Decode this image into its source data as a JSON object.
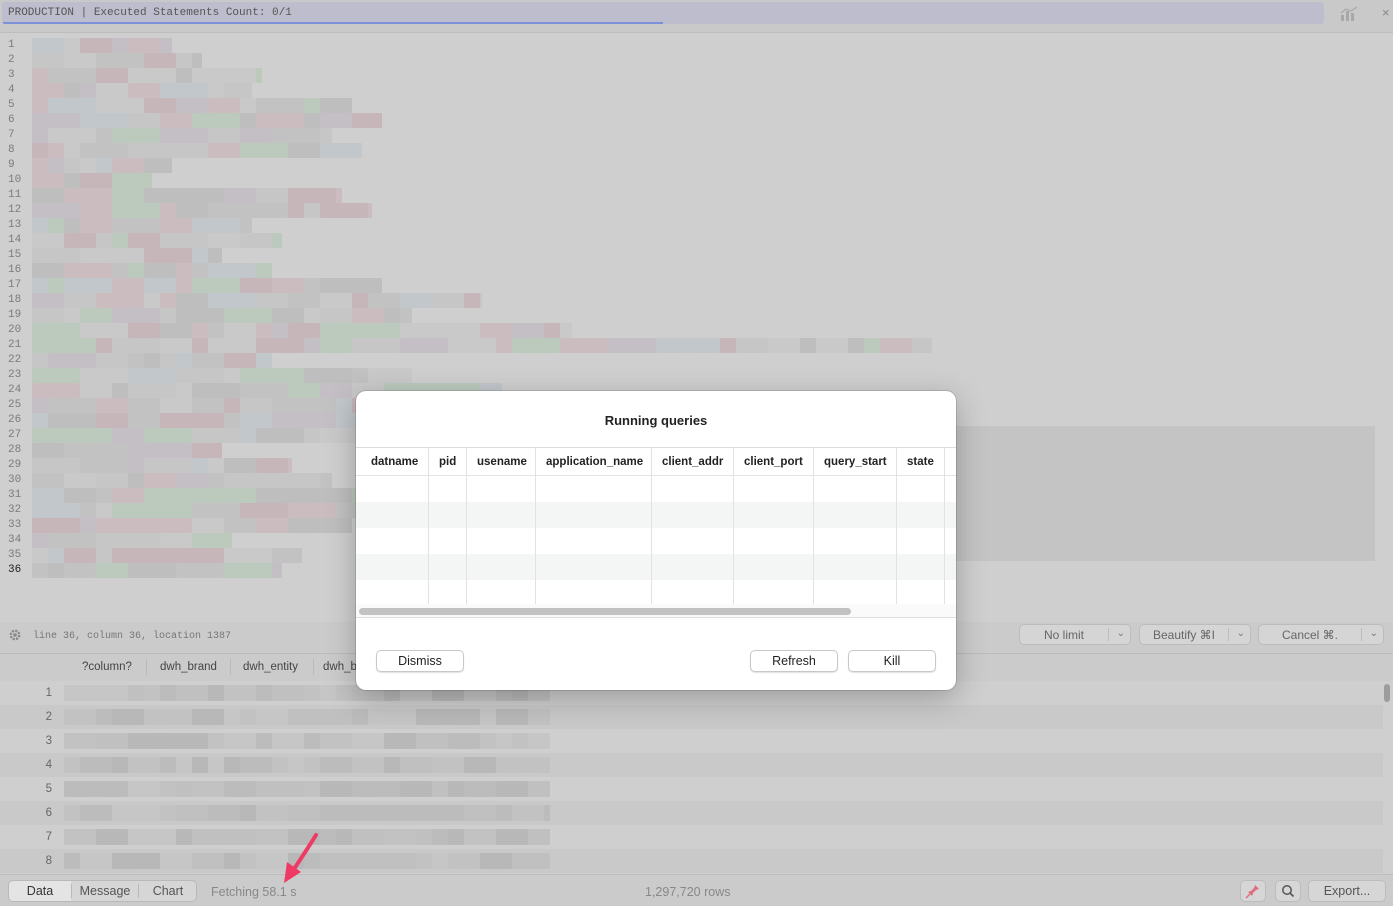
{
  "topbar": {
    "status_text": "PRODUCTION | Executed Statements Count: 0/1",
    "progress_fraction": 0.5,
    "progress_color": "#7d8fd8",
    "close_symbol": "×",
    "chart_icon": "chart-icon"
  },
  "editor": {
    "line_numbers": [
      "1",
      "2",
      "3",
      "4",
      "5",
      "6",
      "7",
      "8",
      "9",
      "10",
      "11",
      "12",
      "13",
      "14",
      "15",
      "16",
      "17",
      "18",
      "19",
      "20",
      "21",
      "22",
      "23",
      "24",
      "25",
      "26",
      "27",
      "28",
      "29",
      "30",
      "31",
      "32",
      "33",
      "34",
      "35",
      "36"
    ],
    "active_line": "36",
    "cursor_text": "line 36, column 36, location 1387"
  },
  "toolbar": {
    "limit_label": "No limit",
    "beautify_label": "Beautify ⌘I",
    "cancel_label": "Cancel ⌘.",
    "chevron": "⌄"
  },
  "grid": {
    "columns": [
      "?column?",
      "dwh_brand",
      "dwh_entity",
      "dwh_b"
    ],
    "row_numbers": [
      "1",
      "2",
      "3",
      "4",
      "5",
      "6",
      "7",
      "8"
    ]
  },
  "bottombar": {
    "tabs": [
      "Data",
      "Message",
      "Chart"
    ],
    "selected_tab": "Data",
    "fetch_text": "Fetching 58.1 s",
    "rows_text": "1,297,720 rows",
    "export_label": "Export...",
    "arrow_color": "#ee3a64"
  },
  "modal": {
    "title": "Running queries",
    "columns": [
      "datname",
      "pid",
      "usename",
      "application_name",
      "client_addr",
      "client_port",
      "query_start",
      "state"
    ],
    "dismiss_label": "Dismiss",
    "refresh_label": "Refresh",
    "kill_label": "Kill"
  }
}
